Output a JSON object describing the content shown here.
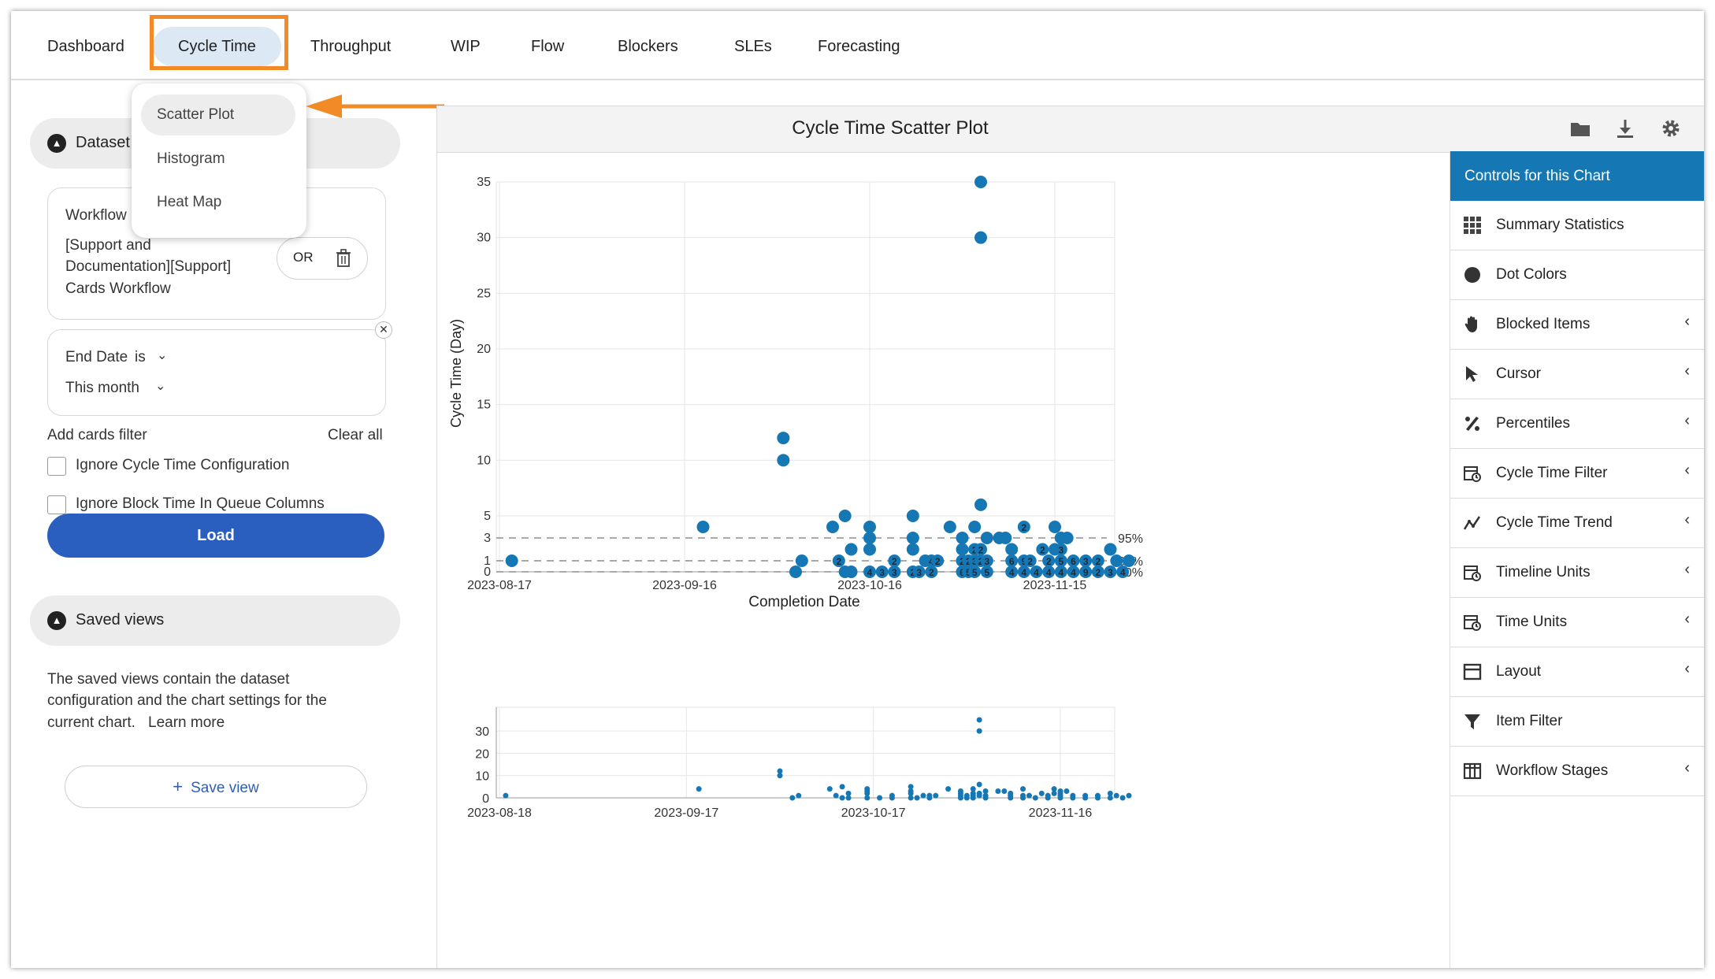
{
  "nav": {
    "tabs": [
      "Dashboard",
      "Cycle Time",
      "Throughput",
      "WIP",
      "Flow",
      "Blockers",
      "SLEs",
      "Forecasting"
    ],
    "active_tab": "Cycle Time"
  },
  "dropdown": {
    "items": [
      "Scatter Plot",
      "Histogram",
      "Heat Map"
    ],
    "selected": "Scatter Plot"
  },
  "dataset": {
    "title": "Dataset",
    "workflow_label": "Workflow",
    "workflow_value": "[Support and Documentation][Support] Cards Workflow",
    "workflow_line1": "[Support and",
    "workflow_line2": "Documentation][Support]",
    "workflow_line3": "Cards Workflow",
    "or_label": "OR",
    "end_date_label": "End Date",
    "is_label": "is",
    "end_date_value": "This month",
    "add_filter": "Add cards filter",
    "clear_all": "Clear all",
    "ignore_cycle_time": "Ignore Cycle Time Configuration",
    "ignore_block_time": "Ignore Block Time In Queue Columns",
    "load": "Load"
  },
  "saved_views": {
    "title": "Saved views",
    "description_line1": "The saved views contain the dataset",
    "description_line2": "configuration and the chart settings for the",
    "description_line3": "current chart.",
    "learn_more": "Learn more",
    "save_button": "Save view"
  },
  "chart_header": {
    "title": "Cycle Time Scatter Plot",
    "icons": [
      "folder-icon",
      "download-icon",
      "gear-icon"
    ]
  },
  "controls": {
    "header": "Controls for this Chart",
    "items": [
      {
        "label": "Summary Statistics",
        "icon": "grid-icon",
        "expandable": false
      },
      {
        "label": "Dot Colors",
        "icon": "circle-icon",
        "expandable": false
      },
      {
        "label": "Blocked Items",
        "icon": "hand-icon",
        "expandable": true
      },
      {
        "label": "Cursor",
        "icon": "cursor-icon",
        "expandable": true
      },
      {
        "label": "Percentiles",
        "icon": "percent-icon",
        "expandable": true
      },
      {
        "label": "Cycle Time Filter",
        "icon": "calendar-icon",
        "expandable": true
      },
      {
        "label": "Cycle Time Trend",
        "icon": "trend-icon",
        "expandable": true
      },
      {
        "label": "Timeline Units",
        "icon": "calendar-icon",
        "expandable": true
      },
      {
        "label": "Time Units",
        "icon": "calendar-icon",
        "expandable": true
      },
      {
        "label": "Layout",
        "icon": "layout-icon",
        "expandable": true
      },
      {
        "label": "Item Filter",
        "icon": "filter-icon",
        "expandable": false
      },
      {
        "label": "Workflow Stages",
        "icon": "columns-icon",
        "expandable": true
      }
    ]
  },
  "colors": {
    "accent": "#1677b5",
    "dot": "#1677b5",
    "button": "#2a5fbf",
    "highlight": "#f28a25"
  },
  "chart_data": [
    {
      "type": "scatter",
      "title": "",
      "xlabel": "Completion Date",
      "ylabel": "Cycle Time (Day)",
      "ylim": [
        0,
        36
      ],
      "xlim": [
        "2023-08-17",
        "2023-11-28"
      ],
      "x_ticks": [
        "2023-08-17",
        "2023-09-16",
        "2023-10-16",
        "2023-11-15"
      ],
      "y_ticks": [
        0,
        1,
        3,
        5,
        10,
        15,
        20,
        25,
        30,
        35
      ],
      "grid": true,
      "percentiles": [
        {
          "label": "95%",
          "value": 3
        },
        {
          "label": "85%",
          "value": 1
        },
        {
          "label": "50%",
          "value": 0
        }
      ],
      "points": [
        {
          "x": "2023-08-19",
          "y": 1
        },
        {
          "x": "2023-09-19",
          "y": 4
        },
        {
          "x": "2023-10-02",
          "y": 12
        },
        {
          "x": "2023-10-02",
          "y": 10
        },
        {
          "x": "2023-10-04",
          "y": 0
        },
        {
          "x": "2023-10-05",
          "y": 1
        },
        {
          "x": "2023-10-10",
          "y": 4
        },
        {
          "x": "2023-10-11",
          "y": 1,
          "n": "2"
        },
        {
          "x": "2023-10-12",
          "y": 5
        },
        {
          "x": "2023-10-12",
          "y": 0
        },
        {
          "x": "2023-10-13",
          "y": 2
        },
        {
          "x": "2023-10-13",
          "y": 0
        },
        {
          "x": "2023-10-16",
          "y": 4
        },
        {
          "x": "2023-10-16",
          "y": 3
        },
        {
          "x": "2023-10-16",
          "y": 2
        },
        {
          "x": "2023-10-16",
          "y": 0,
          "n": "4"
        },
        {
          "x": "2023-10-18",
          "y": 0,
          "n": "3"
        },
        {
          "x": "2023-10-20",
          "y": 0,
          "n": "3"
        },
        {
          "x": "2023-10-20",
          "y": 1,
          "n": "2"
        },
        {
          "x": "2023-10-23",
          "y": 5
        },
        {
          "x": "2023-10-23",
          "y": 3
        },
        {
          "x": "2023-10-23",
          "y": 2
        },
        {
          "x": "2023-10-23",
          "y": 0,
          "n": "2"
        },
        {
          "x": "2023-10-24",
          "y": 0,
          "n": "3"
        },
        {
          "x": "2023-10-25",
          "y": 1
        },
        {
          "x": "2023-10-26",
          "y": 1,
          "n": "4"
        },
        {
          "x": "2023-10-26",
          "y": 0,
          "n": "2"
        },
        {
          "x": "2023-10-27",
          "y": 1,
          "n": "2"
        },
        {
          "x": "2023-10-29",
          "y": 4
        },
        {
          "x": "2023-10-31",
          "y": 3
        },
        {
          "x": "2023-10-31",
          "y": 2
        },
        {
          "x": "2023-10-31",
          "y": 1,
          "n": "2"
        },
        {
          "x": "2023-10-31",
          "y": 0,
          "n": "6"
        },
        {
          "x": "2023-11-02",
          "y": 4
        },
        {
          "x": "2023-11-03",
          "y": 35
        },
        {
          "x": "2023-11-03",
          "y": 30
        },
        {
          "x": "2023-11-03",
          "y": 6
        },
        {
          "x": "2023-11-02",
          "y": 2,
          "n": "2"
        },
        {
          "x": "2023-11-03",
          "y": 2,
          "n": "2"
        },
        {
          "x": "2023-11-01",
          "y": 1,
          "n": "2"
        },
        {
          "x": "2023-11-02",
          "y": 1,
          "n": "3"
        },
        {
          "x": "2023-11-03",
          "y": 1,
          "n": "2"
        },
        {
          "x": "2023-11-04",
          "y": 1,
          "n": "3"
        },
        {
          "x": "2023-11-01",
          "y": 0,
          "n": "5"
        },
        {
          "x": "2023-11-02",
          "y": 0,
          "n": "5"
        },
        {
          "x": "2023-11-04",
          "y": 0,
          "n": "5"
        },
        {
          "x": "2023-11-04",
          "y": 3
        },
        {
          "x": "2023-11-06",
          "y": 3
        },
        {
          "x": "2023-11-07",
          "y": 3
        },
        {
          "x": "2023-11-08",
          "y": 2
        },
        {
          "x": "2023-11-08",
          "y": 1,
          "n": "6"
        },
        {
          "x": "2023-11-10",
          "y": 1,
          "n": "9"
        },
        {
          "x": "2023-11-11",
          "y": 1,
          "n": "2"
        },
        {
          "x": "2023-11-08",
          "y": 0,
          "n": "4"
        },
        {
          "x": "2023-11-10",
          "y": 0,
          "n": "4"
        },
        {
          "x": "2023-11-12",
          "y": 0,
          "n": "4"
        },
        {
          "x": "2023-11-10",
          "y": 4,
          "n": "2"
        },
        {
          "x": "2023-11-13",
          "y": 2,
          "n": "2"
        },
        {
          "x": "2023-11-15",
          "y": 2
        },
        {
          "x": "2023-11-16",
          "y": 2,
          "n": "3"
        },
        {
          "x": "2023-11-15",
          "y": 4
        },
        {
          "x": "2023-11-16",
          "y": 3
        },
        {
          "x": "2023-11-17",
          "y": 3
        },
        {
          "x": "2023-11-14",
          "y": 1,
          "n": "2"
        },
        {
          "x": "2023-11-16",
          "y": 1,
          "n": "5"
        },
        {
          "x": "2023-11-18",
          "y": 1,
          "n": "6"
        },
        {
          "x": "2023-11-20",
          "y": 1,
          "n": "3"
        },
        {
          "x": "2023-11-22",
          "y": 1,
          "n": "2"
        },
        {
          "x": "2023-11-14",
          "y": 0,
          "n": "4"
        },
        {
          "x": "2023-11-16",
          "y": 0,
          "n": "4"
        },
        {
          "x": "2023-11-18",
          "y": 0,
          "n": "4"
        },
        {
          "x": "2023-11-20",
          "y": 0,
          "n": "9"
        },
        {
          "x": "2023-11-22",
          "y": 0,
          "n": "2"
        },
        {
          "x": "2023-11-24",
          "y": 0,
          "n": "3"
        },
        {
          "x": "2023-11-26",
          "y": 0,
          "n": "4"
        },
        {
          "x": "2023-11-24",
          "y": 2
        },
        {
          "x": "2023-11-25",
          "y": 1
        },
        {
          "x": "2023-11-27",
          "y": 1
        }
      ]
    },
    {
      "type": "scatter",
      "title": "",
      "xlabel": "",
      "ylabel": "",
      "ylim": [
        0,
        36
      ],
      "xlim": [
        "2023-08-18",
        "2023-11-26"
      ],
      "x_ticks": [
        "2023-08-18",
        "2023-09-17",
        "2023-10-17",
        "2023-11-16"
      ],
      "y_ticks": [
        0,
        10,
        20,
        30
      ],
      "grid": true
    }
  ]
}
